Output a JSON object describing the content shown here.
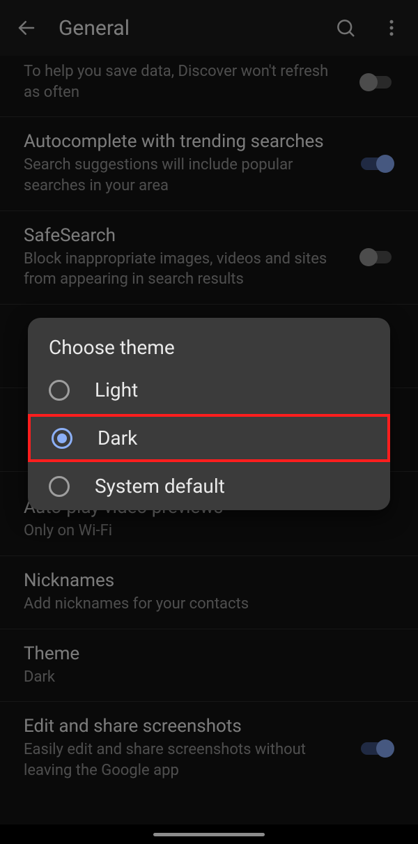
{
  "header": {
    "title": "General"
  },
  "items": {
    "discover": {
      "sub": "To help you save data, Discover won't refresh as often"
    },
    "autocomplete": {
      "title": "Autocomplete with trending searches",
      "sub": "Search suggestions will include popular searches in your area"
    },
    "safesearch": {
      "title": "SafeSearch",
      "sub": "Block inappropriate images, videos and sites from appearing in search results"
    },
    "autoplay": {
      "title": "Auto-play video previews",
      "sub": "Only on Wi-Fi"
    },
    "nicknames": {
      "title": "Nicknames",
      "sub": "Add nicknames for your contacts"
    },
    "theme": {
      "title": "Theme",
      "sub": "Dark"
    },
    "screenshots": {
      "title": "Edit and share screenshots",
      "sub": "Easily edit and share screenshots without leaving the Google app"
    }
  },
  "dialog": {
    "title": "Choose theme",
    "options": {
      "light": "Light",
      "dark": "Dark",
      "system": "System default"
    },
    "selected": "dark"
  }
}
